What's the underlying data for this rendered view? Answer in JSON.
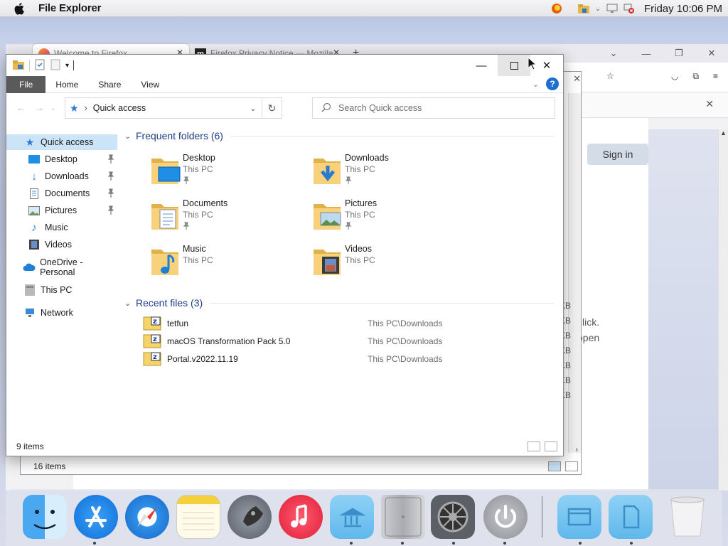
{
  "menubar": {
    "app_name": "File Explorer",
    "clock": "Friday 10:06 PM"
  },
  "firefox": {
    "tabs": [
      {
        "label": "Welcome to Firefox"
      },
      {
        "label": "Firefox Privacy Notice — Mozilla"
      }
    ],
    "sign_in": "Sign in",
    "side_text": [
      "click.",
      "open"
    ],
    "size_labels": [
      "KB",
      "KB",
      "KB",
      "KB",
      "KB",
      "KB",
      "KB"
    ]
  },
  "explorer_back": {
    "status": "16 items"
  },
  "explorer": {
    "ribbon_tabs": [
      "File",
      "Home",
      "Share",
      "View"
    ],
    "address": {
      "path": "Quick access"
    },
    "search": {
      "placeholder": "Search Quick access"
    },
    "nav": {
      "quick_access": "Quick access",
      "items": [
        {
          "label": "Desktop",
          "pinned": true
        },
        {
          "label": "Downloads",
          "pinned": true
        },
        {
          "label": "Documents",
          "pinned": true
        },
        {
          "label": "Pictures",
          "pinned": true
        },
        {
          "label": "Music",
          "pinned": false
        },
        {
          "label": "Videos",
          "pinned": false
        }
      ],
      "onedrive": "OneDrive - Personal",
      "this_pc": "This PC",
      "network": "Network"
    },
    "frequent": {
      "header": "Frequent folders (6)",
      "folders": [
        {
          "name": "Desktop",
          "location": "This PC"
        },
        {
          "name": "Downloads",
          "location": "This PC"
        },
        {
          "name": "Documents",
          "location": "This PC"
        },
        {
          "name": "Pictures",
          "location": "This PC"
        },
        {
          "name": "Music",
          "location": "This PC"
        },
        {
          "name": "Videos",
          "location": "This PC"
        }
      ]
    },
    "recent": {
      "header": "Recent files (3)",
      "files": [
        {
          "name": "tetfun",
          "location": "This PC\\Downloads"
        },
        {
          "name": "macOS Transformation Pack 5.0",
          "location": "This PC\\Downloads"
        },
        {
          "name": "Portal.v2022.11.19",
          "location": "This PC\\Downloads"
        }
      ]
    },
    "status": "9 items"
  },
  "dock": {
    "items": [
      "finder-icon",
      "app-store-icon",
      "safari-icon",
      "notes-icon",
      "launchpad-icon",
      "music-icon",
      "folder-library-icon",
      "mac-pro-icon",
      "system-preferences-icon",
      "power-icon",
      "folder-window-icon",
      "folder-documents-icon",
      "trash-icon"
    ]
  }
}
